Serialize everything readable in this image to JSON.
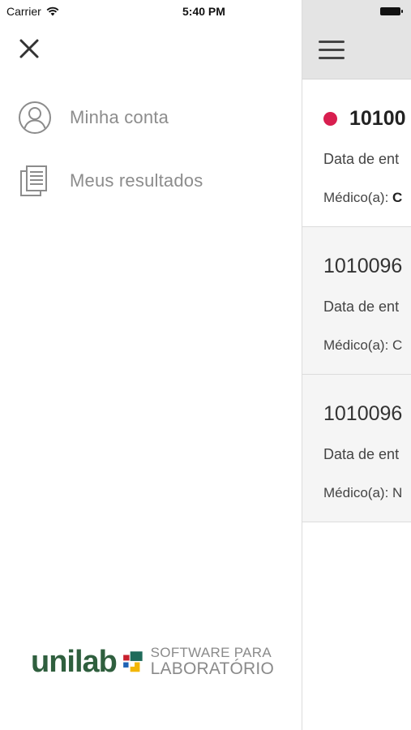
{
  "status_bar": {
    "carrier": "Carrier",
    "time": "5:40 PM"
  },
  "menu": {
    "items": [
      {
        "label": "Minha conta",
        "icon": "user-circle-icon"
      },
      {
        "label": "Meus resultados",
        "icon": "documents-icon"
      }
    ]
  },
  "logo": {
    "word": "unilab",
    "tagline_1": "SOFTWARE PARA",
    "tagline_2": "LABORATÓRIO",
    "colors": {
      "green": "#2f5f3e",
      "red": "#c8202e",
      "blue": "#1e63b5",
      "yellow": "#f2b705",
      "teal": "#1f6b5a"
    }
  },
  "panel": {
    "cards": [
      {
        "number": "10100",
        "date_label": "Data de ent",
        "doctor_label": "Médico(a): ",
        "doctor_value": "C",
        "unread": true
      },
      {
        "number": "1010096",
        "date_label": "Data de ent",
        "doctor_label": "Médico(a): C",
        "unread": false
      },
      {
        "number": "1010096",
        "date_label": "Data de ent",
        "doctor_label": "Médico(a): N",
        "unread": false
      }
    ]
  },
  "colors": {
    "accent_dot": "#d81e4f",
    "header_bg": "#e4e4e4",
    "menu_text": "#8c8c8c"
  }
}
